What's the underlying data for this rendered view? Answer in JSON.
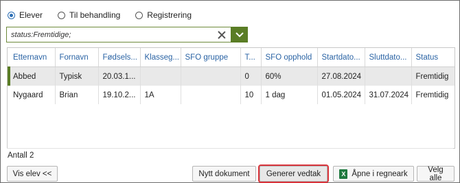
{
  "radios": [
    {
      "label": "Elever",
      "checked": true
    },
    {
      "label": "Til behandling",
      "checked": false
    },
    {
      "label": "Registrering",
      "checked": false
    }
  ],
  "filter": {
    "value": "status:Fremtidige;"
  },
  "columns": [
    "Etternavn",
    "Fornavn",
    "Fødsels...",
    "Klasseg...",
    "SFO gruppe",
    "T...",
    "SFO opphold",
    "Startdato...",
    "Sluttdato...",
    "Status"
  ],
  "rows": [
    [
      "Abbed",
      "Typisk",
      "20.03.1...",
      "",
      "",
      "0",
      "60%",
      "27.08.2024",
      "",
      "Fremtidig"
    ],
    [
      "Nygaard",
      "Brian",
      "19.10.2...",
      "1A",
      "",
      "10",
      "1 dag",
      "01.05.2024",
      "31.07.2024",
      "Fremtidig"
    ]
  ],
  "selected_row": 0,
  "count_label": "Antall 2",
  "buttons": {
    "vis_elev": "Vis elev <<",
    "nytt_dokument": "Nytt dokument",
    "generer_vedtak": "Generer vedtak",
    "apne_regneark": "Åpne i regneark",
    "velg_alle": "Velg alle"
  },
  "colors": {
    "accent_green": "#5a7d25",
    "header_blue": "#2a63a4",
    "highlight_red": "#d9343b"
  },
  "icons": {
    "clear": "close-icon",
    "dropdown": "chevron-down-icon",
    "excel": "excel-icon"
  }
}
